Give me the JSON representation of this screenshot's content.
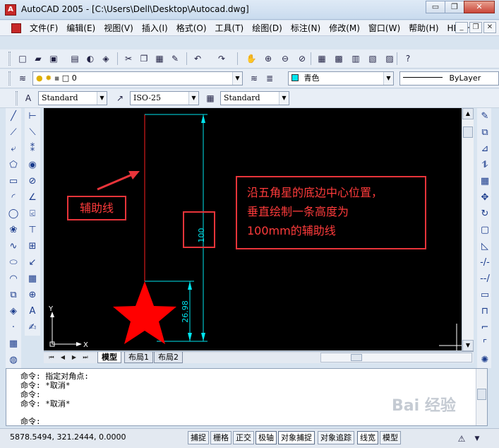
{
  "window": {
    "title": "AutoCAD 2005 - [C:\\Users\\Dell\\Desktop\\Autocad.dwg]",
    "minimize_glyph": "▭",
    "restore_glyph": "❐",
    "close_glyph": "✕"
  },
  "menu": [
    "文件(F)",
    "编辑(E)",
    "视图(V)",
    "插入(I)",
    "格式(O)",
    "工具(T)",
    "绘图(D)",
    "标注(N)",
    "修改(M)",
    "窗口(W)",
    "帮助(H)",
    "HDSHM"
  ],
  "mdi": {
    "min": "_",
    "restore": "❐",
    "close": "✕"
  },
  "layer_bar": {
    "layer_value": "0",
    "color_value": "青色",
    "linetype_value": "ByLayer",
    "color_hex": "#00e5ee"
  },
  "styles_bar": {
    "text_style": "Standard",
    "dim_style": "ISO-25",
    "table_style": "Standard"
  },
  "drawing": {
    "dim_long": "100",
    "dim_short": "26.98",
    "label_aux": "辅助线",
    "note_lines": [
      "沿五角星的底边中心位置，",
      "垂直绘制一条高度为",
      "100mm的辅助线"
    ],
    "axis_y": "Y",
    "axis_x": "X",
    "annotation_color": "#e8343a",
    "star_color": "#ff0000",
    "aux_line_color": "#ff2020",
    "dim_color": "#00e5ee"
  },
  "layout_tabs": [
    "模型",
    "布局1",
    "布局2"
  ],
  "command": {
    "lines": [
      "命令: 指定对角点:",
      "命令: *取消*",
      "命令:",
      "命令: *取消*"
    ],
    "prompt": "命令:"
  },
  "status": {
    "coords": "5878.5494, 321.2444, 0.0000",
    "buttons": [
      "捕捉",
      "栅格",
      "正交",
      "极轴",
      "对象捕捉",
      "对象追踪",
      "线宽",
      "模型"
    ]
  },
  "watermark": "Bai 经验"
}
